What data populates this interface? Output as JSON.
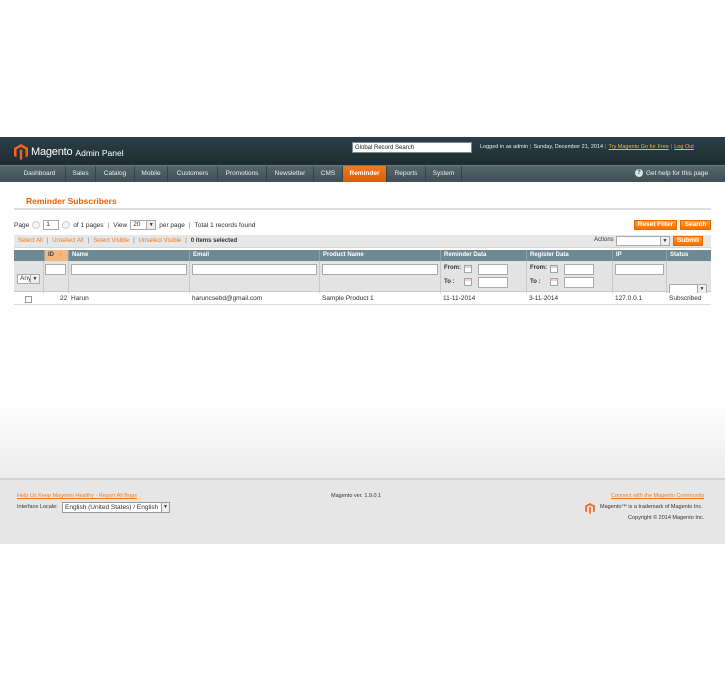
{
  "header": {
    "brand": "Magento",
    "brand_sub": "Admin Panel",
    "search_value": "Global Record Search",
    "logged_in": "Logged in as admin",
    "date": "Sunday, December 21, 2014",
    "try_link": "Try Magento Go for Free",
    "logout": "Log Out"
  },
  "nav": {
    "items": [
      "Dashboard",
      "Sales",
      "Catalog",
      "Mobile",
      "Customers",
      "Promotions",
      "Newsletter",
      "CMS",
      "Reminder",
      "Reports",
      "System"
    ],
    "active": "Reminder",
    "help": "Get help for this page"
  },
  "page": {
    "title": "Reminder Subscribers"
  },
  "pager": {
    "page_label": "Page",
    "page_value": "1",
    "of_pages": "of 1 pages",
    "view_label": "View",
    "per_page_value": "20",
    "per_page_label": "per page",
    "total": "Total 1 records found"
  },
  "buttons": {
    "reset_filter": "Reset Filter",
    "search": "Search",
    "submit": "Submit"
  },
  "massaction": {
    "select_all": "Select All",
    "unselect_all": "Unselect All",
    "select_visible": "Select Visible",
    "unselect_visible": "Unselect Visible",
    "selected": "0 items selected",
    "actions_label": "Actions"
  },
  "grid": {
    "columns": [
      "ID",
      "Name",
      "Email",
      "Product Name",
      "Reminder Data",
      "Register Data",
      "IP",
      "Status"
    ],
    "filter_any": "Any",
    "from_label": "From:",
    "to_label": "To :",
    "rows": [
      {
        "id": "22",
        "name": "Harun",
        "email": "haruncsebd@gmail.com",
        "product": "Sample Product 1",
        "reminder": "11-11-2014",
        "register": "3-11-2014",
        "ip": "127.0.0.1",
        "status": "Subscribed"
      }
    ]
  },
  "footer": {
    "bug_link": "Help Us Keep Magento Healthy - Report All Bugs",
    "locale_label": "Interface Locale:",
    "locale_value": "English (United States) / English",
    "version": "Magento ver. 1.9.0.1",
    "community_link": "Connect with the Magento Community",
    "trademark": "Magento™ is a trademark of Magento Inc.",
    "copyright": "Copyright © 2014 Magento Inc."
  },
  "colors": {
    "accent": "#eb5e00",
    "header_bg": "#2c3f47",
    "grid_head": "#6f8992"
  }
}
